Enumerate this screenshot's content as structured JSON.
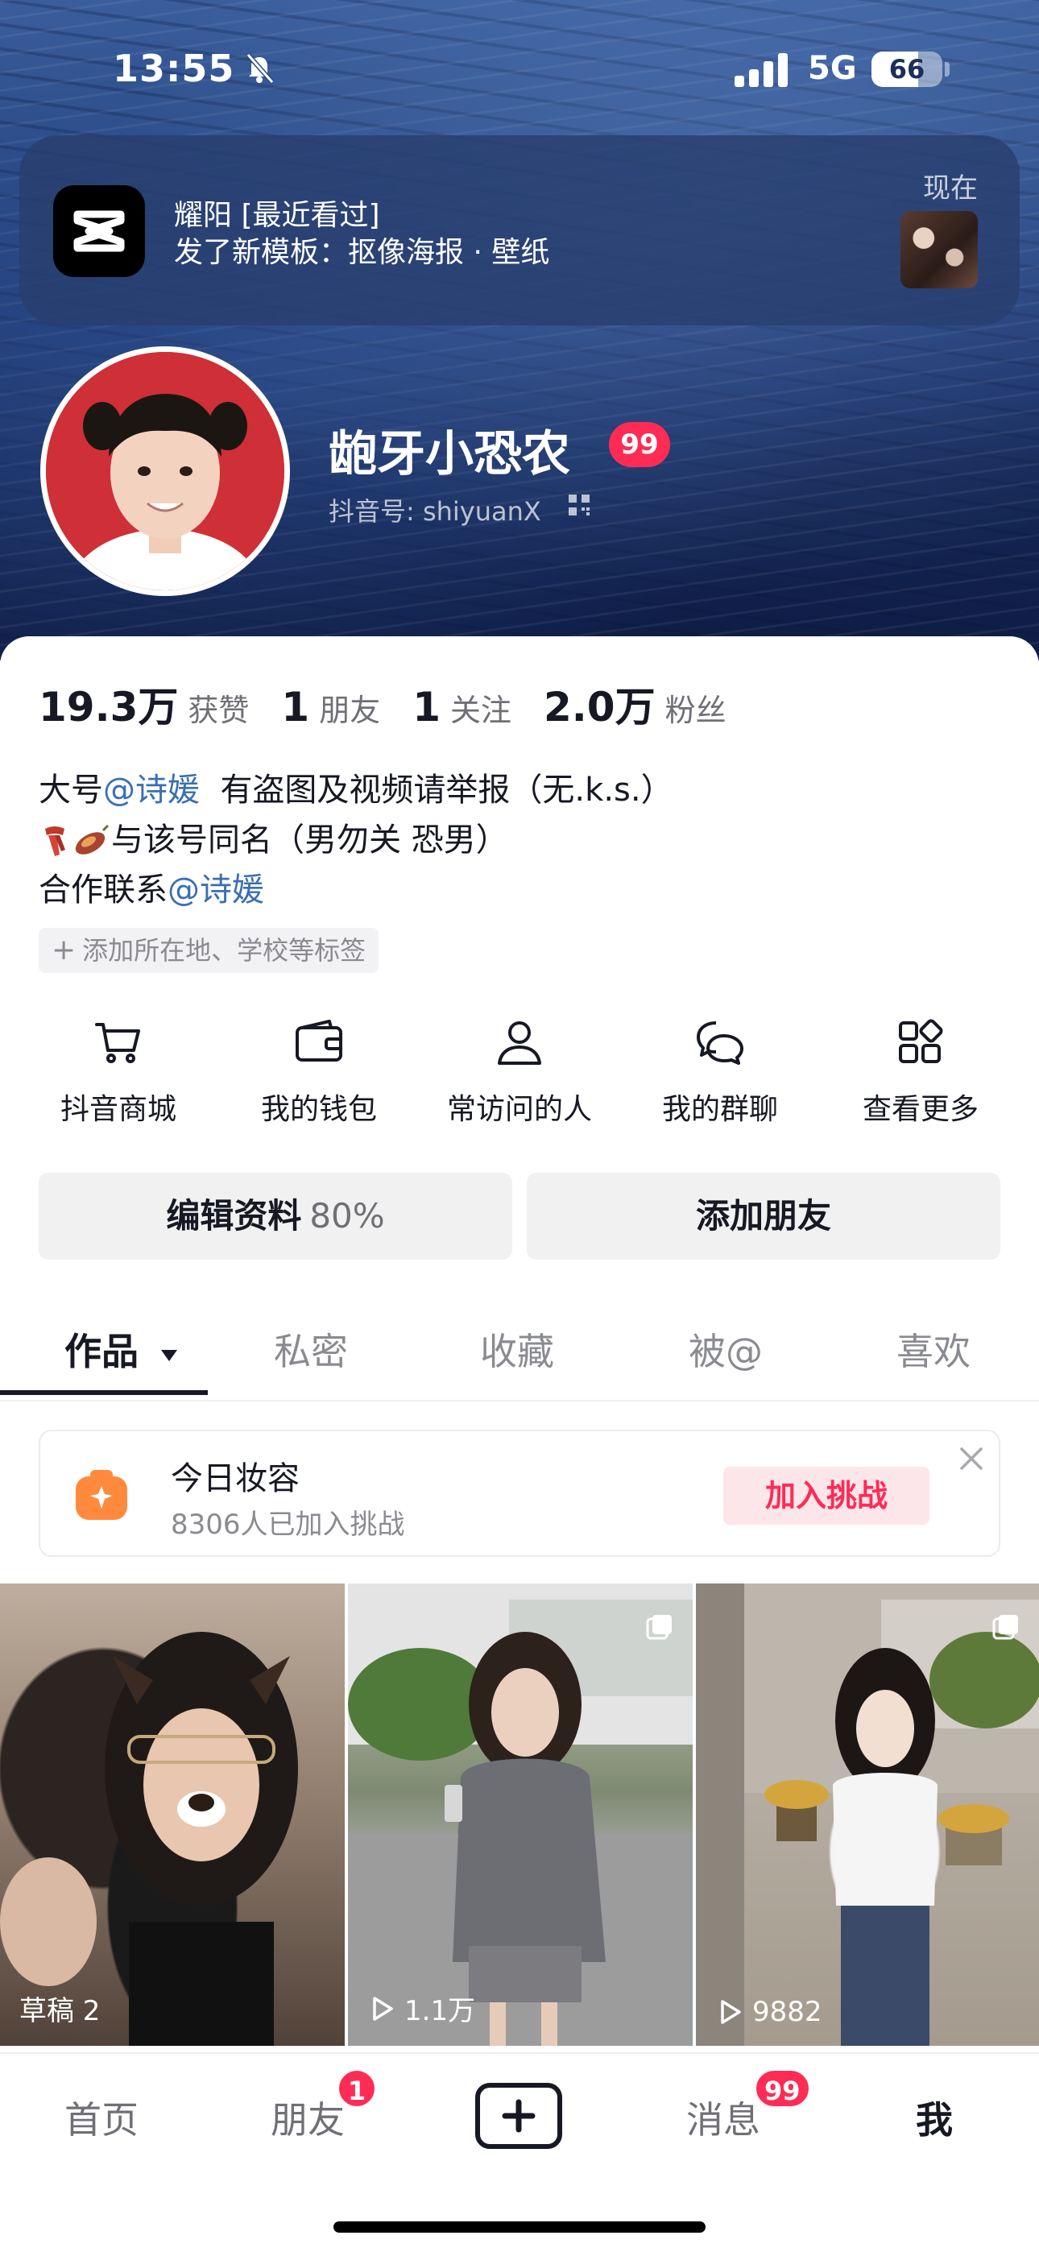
{
  "status_bar": {
    "time": "13:55",
    "network": "5G",
    "battery": "66"
  },
  "notification": {
    "app_icon": "capcut-icon",
    "title": "耀阳 [最近看过]",
    "body": "发了新模板：抠像海报 · 壁纸",
    "time": "现在"
  },
  "profile": {
    "nickname": "龅牙小恐农",
    "nickname_badge": "99",
    "douyin_id": "抖音号: shiyuanX"
  },
  "stats": [
    {
      "value": "19.3万",
      "label": "获赞"
    },
    {
      "value": "1",
      "label": "朋友"
    },
    {
      "value": "1",
      "label": "关注"
    },
    {
      "value": "2.0万",
      "label": "粉丝"
    }
  ],
  "bio": {
    "line1_prefix": "大号",
    "line1_mention": "@诗媛",
    "line1_suffix": "有盗图及视频请举报（无.k.s.）",
    "line2_text": "与该号同名（男勿关 恐男）",
    "line3_prefix": "合作联系",
    "line3_mention": "@诗媛"
  },
  "add_tags": "添加所在地、学校等标签",
  "shortcuts": [
    {
      "label": "抖音商城",
      "icon": "cart-icon"
    },
    {
      "label": "我的钱包",
      "icon": "wallet-icon"
    },
    {
      "label": "常访问的人",
      "icon": "person-icon"
    },
    {
      "label": "我的群聊",
      "icon": "group-chat-icon"
    },
    {
      "label": "查看更多",
      "icon": "grid-more-icon"
    }
  ],
  "buttons": {
    "edit_profile": "编辑资料",
    "edit_progress": "80%",
    "add_friend": "添加朋友"
  },
  "tabs": [
    "作品",
    "私密",
    "收藏",
    "被@",
    "喜欢"
  ],
  "active_tab": "作品",
  "challenge": {
    "title": "今日妆容",
    "subtitle": "8306人已加入挑战",
    "button": "加入挑战"
  },
  "videos": [
    {
      "label": "草稿 2",
      "type": "draft"
    },
    {
      "label": "1.1万",
      "type": "views"
    },
    {
      "label": "9882",
      "type": "views"
    }
  ],
  "bottom_nav": {
    "home": "首页",
    "friends": "朋友",
    "friends_badge": "1",
    "messages": "消息",
    "messages_badge": "99",
    "me": "我"
  },
  "colors": {
    "accent": "#fe2c55",
    "mention": "#3a6fb3",
    "text": "#161823"
  }
}
